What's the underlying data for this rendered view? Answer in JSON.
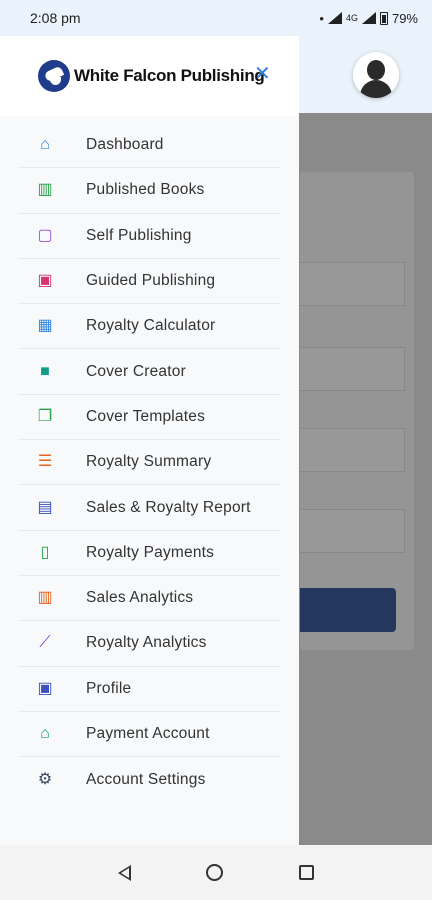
{
  "status_bar": {
    "time": "2:08 pm",
    "network_label": "4G",
    "battery": "79%"
  },
  "drawer": {
    "brand": "White Falcon Publishing",
    "close_glyph": "✕",
    "items": [
      {
        "label": "Dashboard",
        "icon": "home-icon",
        "color": "#2f86e0"
      },
      {
        "label": "Published Books",
        "icon": "books-icon",
        "color": "#27a34a"
      },
      {
        "label": "Self Publishing",
        "icon": "chat-icon",
        "color": "#9b4fd1"
      },
      {
        "label": "Guided Publishing",
        "icon": "guided-icon",
        "color": "#d6336c"
      },
      {
        "label": "Royalty Calculator",
        "icon": "calculator-icon",
        "color": "#2f86e0"
      },
      {
        "label": "Cover Creator",
        "icon": "book-icon",
        "color": "#159a8a"
      },
      {
        "label": "Cover Templates",
        "icon": "open-book-icon",
        "color": "#27a34a"
      },
      {
        "label": "Royalty Summary",
        "icon": "list-icon",
        "color": "#e8621f"
      },
      {
        "label": "Sales & Royalty Report",
        "icon": "report-icon",
        "color": "#3b4fbf"
      },
      {
        "label": "Royalty Payments",
        "icon": "document-icon",
        "color": "#27a34a"
      },
      {
        "label": "Sales Analytics",
        "icon": "bar-chart-icon",
        "color": "#e8621f"
      },
      {
        "label": "Royalty Analytics",
        "icon": "line-chart-icon",
        "color": "#7b3fc4"
      },
      {
        "label": "Profile",
        "icon": "profile-icon",
        "color": "#3b4fbf"
      },
      {
        "label": "Payment Account",
        "icon": "bank-icon",
        "color": "#159a8a"
      },
      {
        "label": "Account Settings",
        "icon": "gear-icon",
        "color": "#3a4a5a"
      }
    ]
  }
}
